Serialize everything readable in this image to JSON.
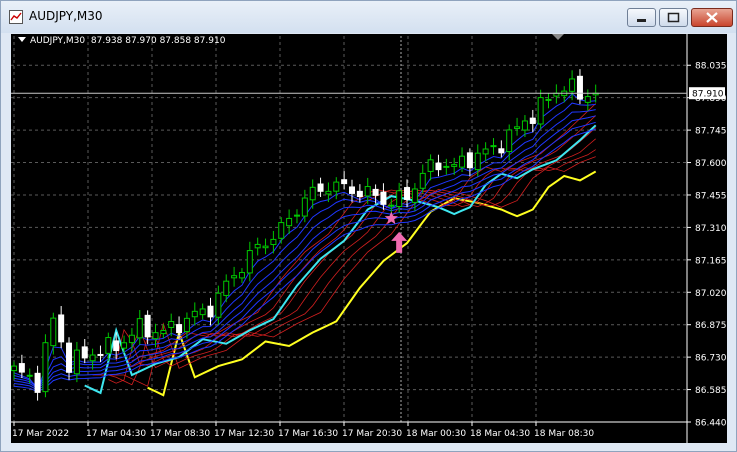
{
  "window": {
    "title": "AUDJPY,M30",
    "min_icon": "minimize-icon",
    "max_icon": "maximize-icon",
    "close_icon": "close-icon"
  },
  "chart_header": {
    "symbol": "AUDJPY,M30",
    "ohlc": "87.938 87.970 87.858 87.910"
  },
  "colors": {
    "background": "#000000",
    "grid": "#5a5a5a",
    "bull_candle": "#00c800",
    "bear_candle": "#ffffff",
    "fast_bands": "#1f37ff",
    "cyan_ma": "#3ee7f0",
    "red_bands": "#d21f1f",
    "yellow_ma": "#ffff20",
    "star": "#f06ab0",
    "arrow": "#f06ab0"
  },
  "chart_data": {
    "type": "candlestick",
    "symbol": "AUDJPY",
    "timeframe": "M30",
    "current_price": 87.91,
    "ylim": [
      86.44,
      88.13
    ],
    "y_ticks": [
      "88.035",
      "87.890",
      "87.745",
      "87.600",
      "87.455",
      "87.310",
      "87.165",
      "87.020",
      "86.875",
      "86.730",
      "86.585",
      "86.440"
    ],
    "x_ticks": [
      "17 Mar 2022",
      "17 Mar 04:30",
      "17 Mar 08:30",
      "17 Mar 12:30",
      "17 Mar 16:30",
      "17 Mar 20:30",
      "18 Mar 00:30",
      "18 Mar 04:30",
      "18 Mar 08:30"
    ],
    "annotations": [
      {
        "type": "star",
        "bar": 48,
        "price": 87.35
      },
      {
        "type": "up-arrow",
        "bar": 49,
        "price": 87.29
      }
    ]
  }
}
